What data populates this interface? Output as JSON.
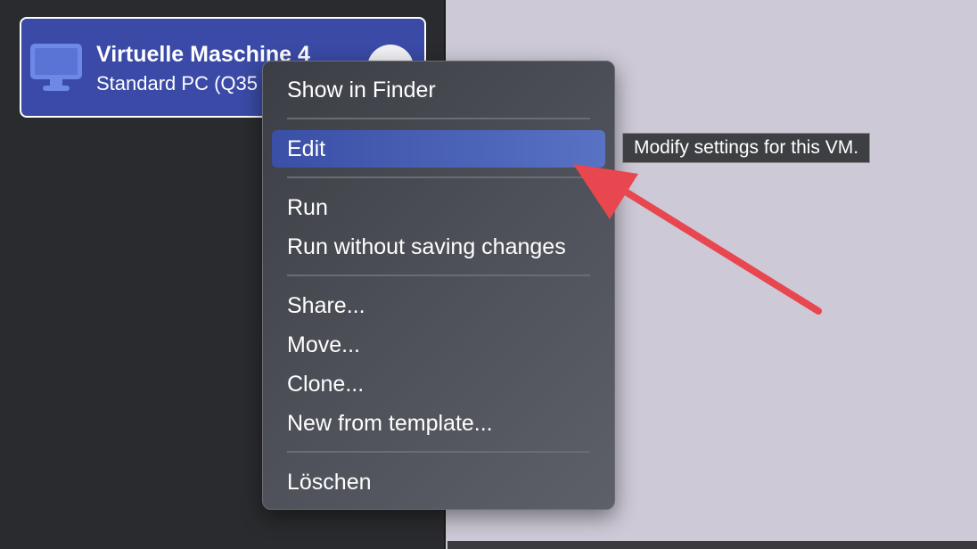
{
  "sidebar": {
    "vm_item": {
      "title": "Virtuelle Maschine 4",
      "subtitle": "Standard PC (Q35",
      "icon": "monitor-icon"
    }
  },
  "context_menu": {
    "groups": [
      [
        {
          "label": "Show in Finder"
        }
      ],
      [
        {
          "label": "Edit",
          "highlighted": true
        }
      ],
      [
        {
          "label": "Run"
        },
        {
          "label": "Run without saving changes"
        }
      ],
      [
        {
          "label": "Share..."
        },
        {
          "label": "Move..."
        },
        {
          "label": "Clone..."
        },
        {
          "label": "New from template..."
        }
      ],
      [
        {
          "label": "Löschen"
        }
      ]
    ]
  },
  "tooltip": {
    "text": "Modify settings for this VM."
  },
  "colors": {
    "sidebar_bg": "#2a2b2e",
    "selection_blue": "#3a4aa6",
    "menu_highlight": "#4a61b8",
    "annotation_red": "#e8474f",
    "content_bg": "#cdc9d6"
  }
}
